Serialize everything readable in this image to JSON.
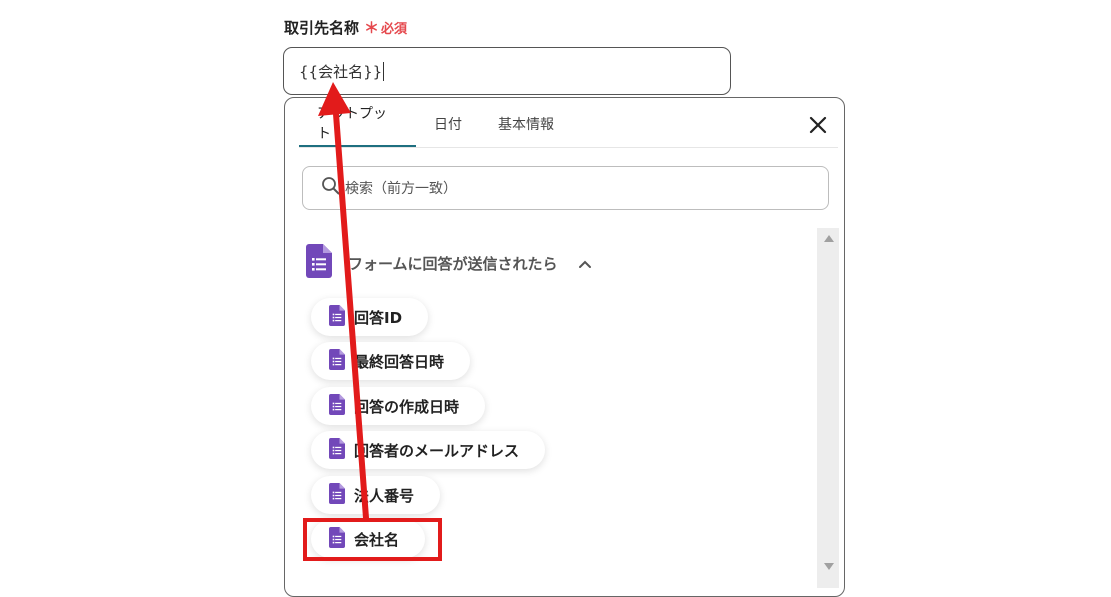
{
  "field": {
    "label": "取引先名称",
    "required_mark": "＊",
    "required_text": "必須",
    "value": "{{会社名}}"
  },
  "popup": {
    "tabs": [
      {
        "label": "アウトプット",
        "active": true
      },
      {
        "label": "日付",
        "active": false
      },
      {
        "label": "基本情報",
        "active": false
      }
    ],
    "search_placeholder": "検索（前方一致）",
    "section": {
      "title": "フォームに回答が送信されたら",
      "icon": "google-forms-icon",
      "expanded": true,
      "items": [
        {
          "label": "回答ID"
        },
        {
          "label": "最終回答日時"
        },
        {
          "label": "回答の作成日時"
        },
        {
          "label": "回答者のメールアドレス"
        },
        {
          "label": "法人番号"
        },
        {
          "label": "会社名"
        }
      ]
    }
  },
  "colors": {
    "accent": "#1e6f80",
    "required": "#e5484d",
    "forms_purple": "#7248b9",
    "annotation_red": "#e21b1b"
  }
}
